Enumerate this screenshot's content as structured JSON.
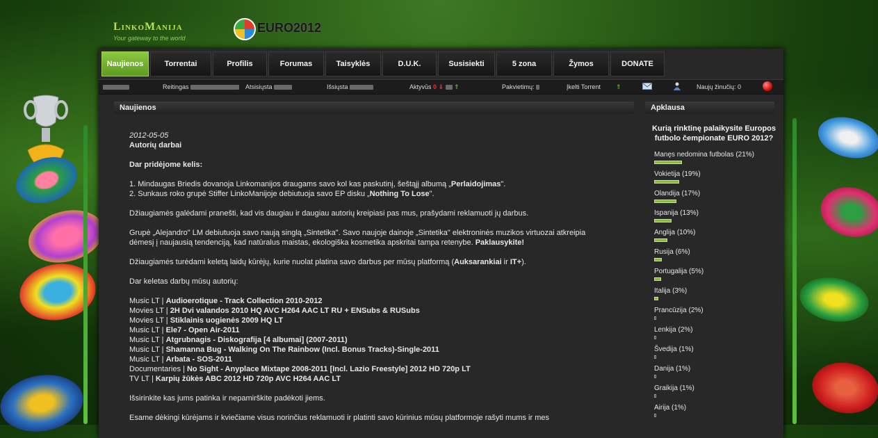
{
  "site": {
    "logo": "LinkoManija",
    "tagline": "Your gateway to the world",
    "event_logo": "EURO2012"
  },
  "nav": {
    "tabs": [
      {
        "label": "Naujienos",
        "active": true
      },
      {
        "label": "Torrentai"
      },
      {
        "label": "Profilis"
      },
      {
        "label": "Forumas"
      },
      {
        "label": "Taisyklės"
      },
      {
        "label": "D.U.K."
      },
      {
        "label": "Susisiekti"
      },
      {
        "label": "5 zona"
      },
      {
        "label": "Žymos"
      },
      {
        "label": "DONATE"
      }
    ]
  },
  "statusbar": {
    "rating_label": "Reitingas",
    "downloaded_label": "Atsisiųsta",
    "uploaded_label": "Išsiųsta",
    "active_label": "Aktyvūs",
    "active_down": "0",
    "invites_label": "Pakvietimų:",
    "upload_torrent": "Įkelti Torrent",
    "new_messages_label": "Naujų žinučių:",
    "new_messages_count": "0"
  },
  "news": {
    "heading": "Naujienos",
    "date": "2012-05-05",
    "title": "Autorių darbai",
    "intro": "Dar pridėjome kelis:",
    "item1_pre": "1. Mindaugas Briedis dovanoja Linkomanijos draugams savo kol kas paskutinį, šeštąjį albumą „",
    "item1_bold": "Perlaidojimas",
    "item1_post": "\".",
    "item2_pre": "2. Sunkaus roko grupė Stiffer LinkoManijoje debiutuoja savo EP disku „",
    "item2_bold": "Nothing To Lose",
    "item2_post": "\".",
    "para1": "Džiaugiamės galėdami pranešti, kad vis daugiau ir daugiau autorių kreipiasi pas mus, prašydami reklamuoti jų darbus.",
    "para2_line1": "Grupė „Alejandro\" LM debiutuoja savo naują singlą „Sintetika\". Savo naujoje dainoje „Sintetika\" elektroninės muzikos virtuozai atkreipia",
    "para2_line2": "dėmesį į naujausią tendenciją, kad natūralus maistas, ekologiška kosmetika apskritai tampa retenybe.",
    "para2_link": "Paklausykite!",
    "para3_pre": "Džiaugiamės turėdami keletą laidų kūrėjų, kurie nuolat platina savo darbus per mūsų platformą (",
    "para3_link1": "Auksarankiai",
    "para3_mid": " ir ",
    "para3_link2": "IT+",
    "para3_post": ").",
    "list_intro": "Dar keletas darbų mūsų autorių:",
    "works": [
      {
        "cat": "Music LT |",
        "title": "Audioerotique - Track Collection 2010-2012"
      },
      {
        "cat": "Movies LT |",
        "title": "2H Dvi valandos 2010 HQ AVC H264 AAC LT RU + ENSubs & RUSubs"
      },
      {
        "cat": "Movies LT |",
        "title": "Stiklainis uogienės 2009 HQ LT"
      },
      {
        "cat": "Music LT |",
        "title": "Ele7 - Open Air-2011"
      },
      {
        "cat": "Music LT |",
        "title": "Atgrubnagis - Diskografija [4 albumai] (2007-2011)"
      },
      {
        "cat": "Music LT |",
        "title": "Shamanna Bug - Walking On The Rainbow (Incl. Bonus Tracks)-Single-2011"
      },
      {
        "cat": "Music LT |",
        "title": "Arbata - SOS-2011"
      },
      {
        "cat": "Documentaries |",
        "title": "No Sight - Anyplace Mixtape 2008-2011 [Incl. Lazio Freestyle] 2012 HD 720p LT"
      },
      {
        "cat": "TV LT |",
        "title": "Karpių žūkės ABC 2012 HD 720p AVC H264 AAC LT"
      }
    ],
    "outro": "Išsirinkite kas jums patinka ir nepamirškite padėkoti jiems.",
    "last_line": "Esame dėkingi kūrėjams ir kviečiame visus norinčius reklamuoti ir platinti savo kūrinius mūsų platformoje rašyti mums ir mes"
  },
  "poll": {
    "heading": "Apklausa",
    "question": "Kurią rinktinę palaikysite Europos futbolo čempionate EURO 2012?",
    "options": [
      {
        "label": "Manęs nedomina futbolas",
        "pct": "(21%)",
        "value": 21
      },
      {
        "label": "Vokietija",
        "pct": "(19%)",
        "value": 19
      },
      {
        "label": "Olandija",
        "pct": "(17%)",
        "value": 17
      },
      {
        "label": "Ispanija",
        "pct": "(13%)",
        "value": 13
      },
      {
        "label": "Anglija",
        "pct": "(10%)",
        "value": 10
      },
      {
        "label": "Rusija",
        "pct": "(6%)",
        "value": 6
      },
      {
        "label": "Portugalija",
        "pct": "(5%)",
        "value": 5
      },
      {
        "label": "Italija",
        "pct": "(3%)",
        "value": 3
      },
      {
        "label": "Prancūzija",
        "pct": "(2%)",
        "value": 2
      },
      {
        "label": "Lenkija",
        "pct": "(2%)",
        "value": 2
      },
      {
        "label": "Švedija",
        "pct": "(1%)",
        "value": 1
      },
      {
        "label": "Danija",
        "pct": "(1%)",
        "value": 1
      },
      {
        "label": "Graikija",
        "pct": "(1%)",
        "value": 1
      },
      {
        "label": "Airija",
        "pct": "(1%)",
        "value": 1
      }
    ]
  },
  "colors": {
    "accent": "#7ab530",
    "panel": "#282828",
    "alert": "#e53030"
  }
}
